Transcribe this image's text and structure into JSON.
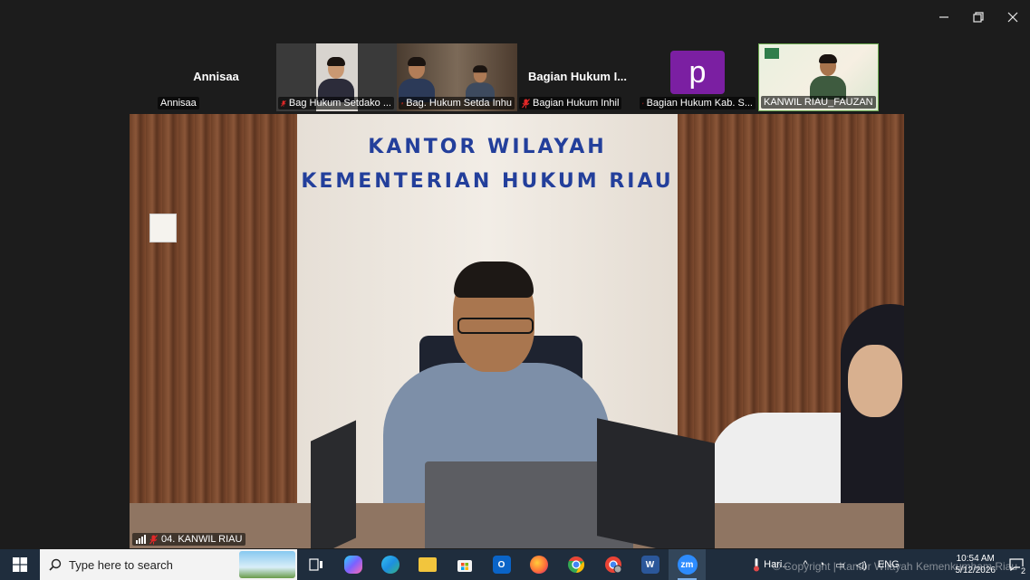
{
  "window": {
    "controls": [
      "minimize",
      "restore",
      "close"
    ]
  },
  "participants": [
    {
      "name": "Annisaa",
      "display_name": "Annisaa",
      "type": "name-only",
      "muted": false
    },
    {
      "name": "Bag Hukum Setdako ...",
      "type": "video",
      "muted": true
    },
    {
      "name": "Bag. Hukum Setda Inhu",
      "type": "video",
      "muted": true
    },
    {
      "name": "Bagian Hukum Inhil",
      "display_name": "Bagian  Hukum  I...",
      "type": "name-only",
      "muted": true
    },
    {
      "name": "Bagian Hukum Kab. S...",
      "avatar_letter": "p",
      "type": "avatar",
      "muted": true
    },
    {
      "name": "KANWIL RIAU_FAUZAN",
      "type": "video",
      "muted": false
    }
  ],
  "main_video": {
    "speaker_label": "04. KANWIL RIAU",
    "muted": true,
    "wall_sign_line1": "KANTOR WILAYAH",
    "wall_sign_line2": "KEMENTERIAN HUKUM RIAU"
  },
  "taskbar": {
    "search_placeholder": "Type here to search",
    "apps": [
      {
        "icon": "task-view-icon",
        "color": "#ffffff"
      },
      {
        "icon": "copilot-icon",
        "color": "#7b61ff"
      },
      {
        "icon": "edge-icon",
        "color": "#1d8fe1"
      },
      {
        "icon": "file-explorer-icon",
        "color": "#f2c53d"
      },
      {
        "icon": "microsoft-store-icon",
        "color": "#f35325"
      },
      {
        "icon": "outlook-icon",
        "color": "#0a64c8"
      },
      {
        "icon": "firefox-icon",
        "color": "#ff7139"
      },
      {
        "icon": "chrome-icon",
        "color": "#34a853"
      },
      {
        "icon": "chrome-profile-icon",
        "color": "#ea4335"
      },
      {
        "icon": "word-icon",
        "color": "#2b579a"
      },
      {
        "icon": "zoom-icon",
        "color": "#2d8cff",
        "label": "zm",
        "active": true
      }
    ],
    "weather_text": "Hari...",
    "language": "ENG",
    "time": "10:54 AM",
    "date": "5/12/2026",
    "notification_count": "2"
  },
  "overlay": {
    "copyright": "© Copyright | Kantor Wilayah Kemenkumham Riau"
  }
}
